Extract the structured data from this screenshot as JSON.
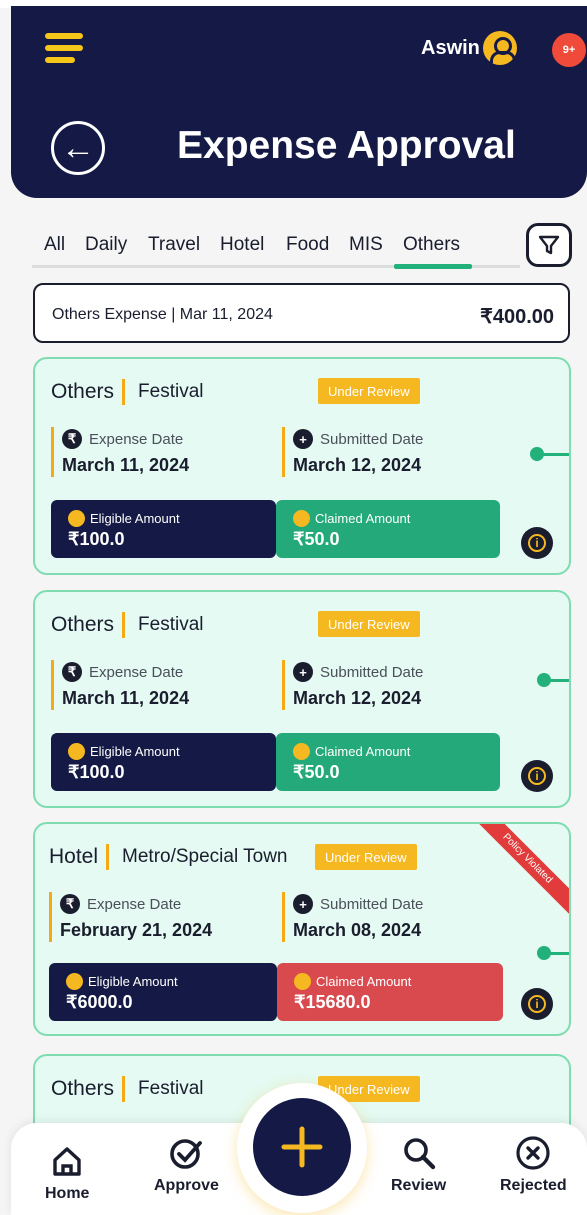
{
  "header": {
    "user_name": "Aswin",
    "notification_count": "9+",
    "title": "Expense Approval"
  },
  "tabs": [
    {
      "label": "All"
    },
    {
      "label": "Daily"
    },
    {
      "label": "Travel"
    },
    {
      "label": "Hotel"
    },
    {
      "label": "Food"
    },
    {
      "label": "MIS"
    },
    {
      "label": "Others",
      "active": true
    }
  ],
  "summary": {
    "category": "Others Expense",
    "separator": "|",
    "date": "Mar 11, 2024",
    "total": "₹400.00"
  },
  "labels": {
    "expense_date": "Expense Date",
    "submitted_date": "Submitted Date",
    "eligible_amount": "Eligible Amount",
    "claimed_amount": "Claimed Amount"
  },
  "cards": [
    {
      "type": "Others",
      "subtype": "Festival",
      "status": "Under Review",
      "expense_date": "March 11, 2024",
      "submitted_date": "March 12, 2024",
      "eligible": "₹100.0",
      "claimed": "₹50.0"
    },
    {
      "type": "Others",
      "subtype": "Festival",
      "status": "Under Review",
      "expense_date": "March 11, 2024",
      "submitted_date": "March 12, 2024",
      "eligible": "₹100.0",
      "claimed": "₹50.0"
    },
    {
      "type": "Hotel",
      "subtype": "Metro/Special Town",
      "status": "Under Review",
      "ribbon": "Policy Violated",
      "expense_date": "February 21, 2024",
      "submitted_date": "March 08, 2024",
      "eligible": "₹6000.0",
      "claimed": "₹15680.0"
    },
    {
      "type": "Others",
      "subtype": "Festival",
      "status": "Under Review"
    }
  ],
  "bottom_nav": [
    {
      "label": "Home",
      "icon": "home-icon"
    },
    {
      "label": "Approve",
      "icon": "check-circle-icon"
    },
    {
      "label": "Review",
      "icon": "search-icon"
    },
    {
      "label": "Rejected",
      "icon": "close-circle-icon"
    }
  ],
  "colors": {
    "navy": "#141a45",
    "accent_yellow": "#f5b820",
    "green": "#22b07b",
    "card_bg": "#e4faf2",
    "claim_ok": "#23a97a",
    "claim_violation": "#d94a4f"
  }
}
